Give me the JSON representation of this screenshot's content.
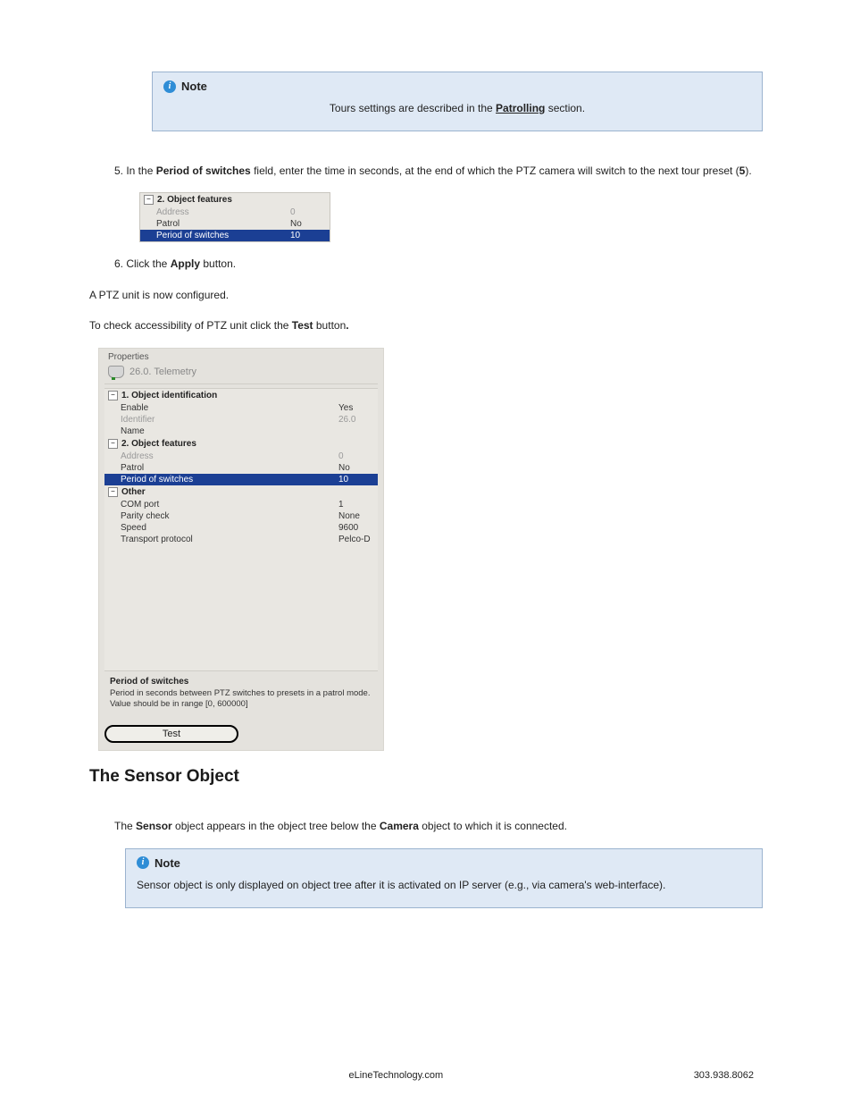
{
  "note1": {
    "label": "Note",
    "body_prefix": "Tours settings are described in the ",
    "link": "Patrolling",
    "body_suffix": " section."
  },
  "step5": {
    "num_label": "5. ",
    "text_before": "In the ",
    "field": "Period of switches",
    "text_mid": " field, enter the time in seconds, at the end of which the PTZ camera will switch to the next tour preset (",
    "ref": "5",
    "text_after": ")."
  },
  "fig_small": {
    "group": "2. Object features",
    "rows": [
      {
        "k": "Address",
        "v": "0",
        "disabled": true
      },
      {
        "k": "Patrol",
        "v": "No"
      },
      {
        "k": "Period of switches",
        "v": "10",
        "selected": true
      }
    ]
  },
  "step6": {
    "num_label": "6. ",
    "text_before": "Click the ",
    "btn": "Apply",
    "text_after": " button."
  },
  "para_test": {
    "t1": "To check accessibility of PTZ unit click the ",
    "btn": "Test",
    "t2": " button",
    "dot": "."
  },
  "fig_large": {
    "legend": "Properties",
    "title": "26.0. Telemetry",
    "groups": [
      {
        "name": "1. Object identification",
        "rows": [
          {
            "k": "Enable",
            "v": "Yes"
          },
          {
            "k": "Identifier",
            "v": "26.0",
            "disabled": true
          },
          {
            "k": "Name",
            "v": ""
          }
        ]
      },
      {
        "name": "2. Object features",
        "rows": [
          {
            "k": "Address",
            "v": "0",
            "disabled": true
          },
          {
            "k": "Patrol",
            "v": "No"
          },
          {
            "k": "Period of switches",
            "v": "10",
            "selected": true
          }
        ]
      },
      {
        "name": "Other",
        "rows": [
          {
            "k": "COM port",
            "v": "1"
          },
          {
            "k": "Parity check",
            "v": "None"
          },
          {
            "k": "Speed",
            "v": "9600"
          },
          {
            "k": "Transport protocol",
            "v": "Pelco-D"
          }
        ]
      }
    ],
    "desc_title": "Period of switches",
    "desc_text": "Period in seconds between PTZ switches to presets in a patrol mode. Value should be in range [0, 600000]",
    "test_btn": "Test"
  },
  "section_heading": "The Sensor Object",
  "sensor_para": {
    "t1": "The ",
    "b1": "Sensor",
    "t2": " object appears in the object tree below the ",
    "b2": "Camera",
    "t3": " object to which it is connected."
  },
  "note2": {
    "label": "Note",
    "body": "Sensor object is only displayed on object tree after it is activated on IP server (e.g., via camera's web-interface)."
  },
  "footer": {
    "left": "eLineTechnology.com",
    "right": "303.938.8062"
  }
}
